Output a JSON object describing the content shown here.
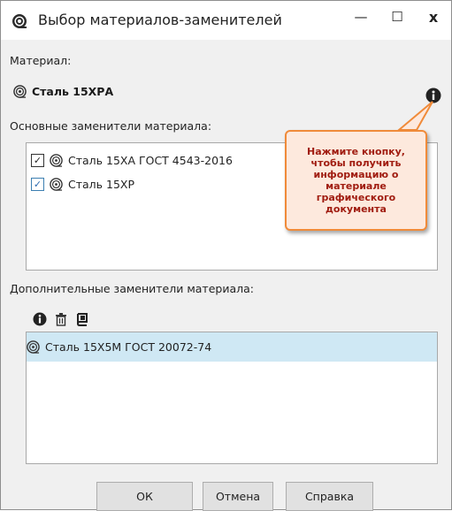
{
  "window": {
    "title": "Выбор материалов-заменителей",
    "controls": {
      "minimize": "—",
      "maximize": "☐",
      "close": "x"
    }
  },
  "material_section": {
    "label": "Материал:",
    "value": "Сталь 15ХРА"
  },
  "primary_substitutes": {
    "label": "Основные заменители материала:",
    "items": [
      {
        "name": "Сталь 15ХА ГОСТ 4543-2016",
        "checked": true
      },
      {
        "name": "Сталь 15ХР",
        "checked": true
      }
    ]
  },
  "callout": {
    "text": "Нажмите кнопку,\nчтобы получить\nинформацию о\nматериале\nграфического\nдокумента"
  },
  "additional_substitutes": {
    "label": "Дополнительные заменители материала:",
    "toolbar": [
      "info-icon",
      "trash-icon",
      "book-icon"
    ],
    "items": [
      {
        "name": "Сталь 15Х5М ГОСТ 20072-74",
        "selected": true
      }
    ]
  },
  "buttons": {
    "ok": "ОК",
    "cancel": "Отмена",
    "help": "Справка"
  },
  "colors": {
    "callout_border": "#f08b3a",
    "callout_text": "#a01c10",
    "selection": "#cfe8f4"
  }
}
